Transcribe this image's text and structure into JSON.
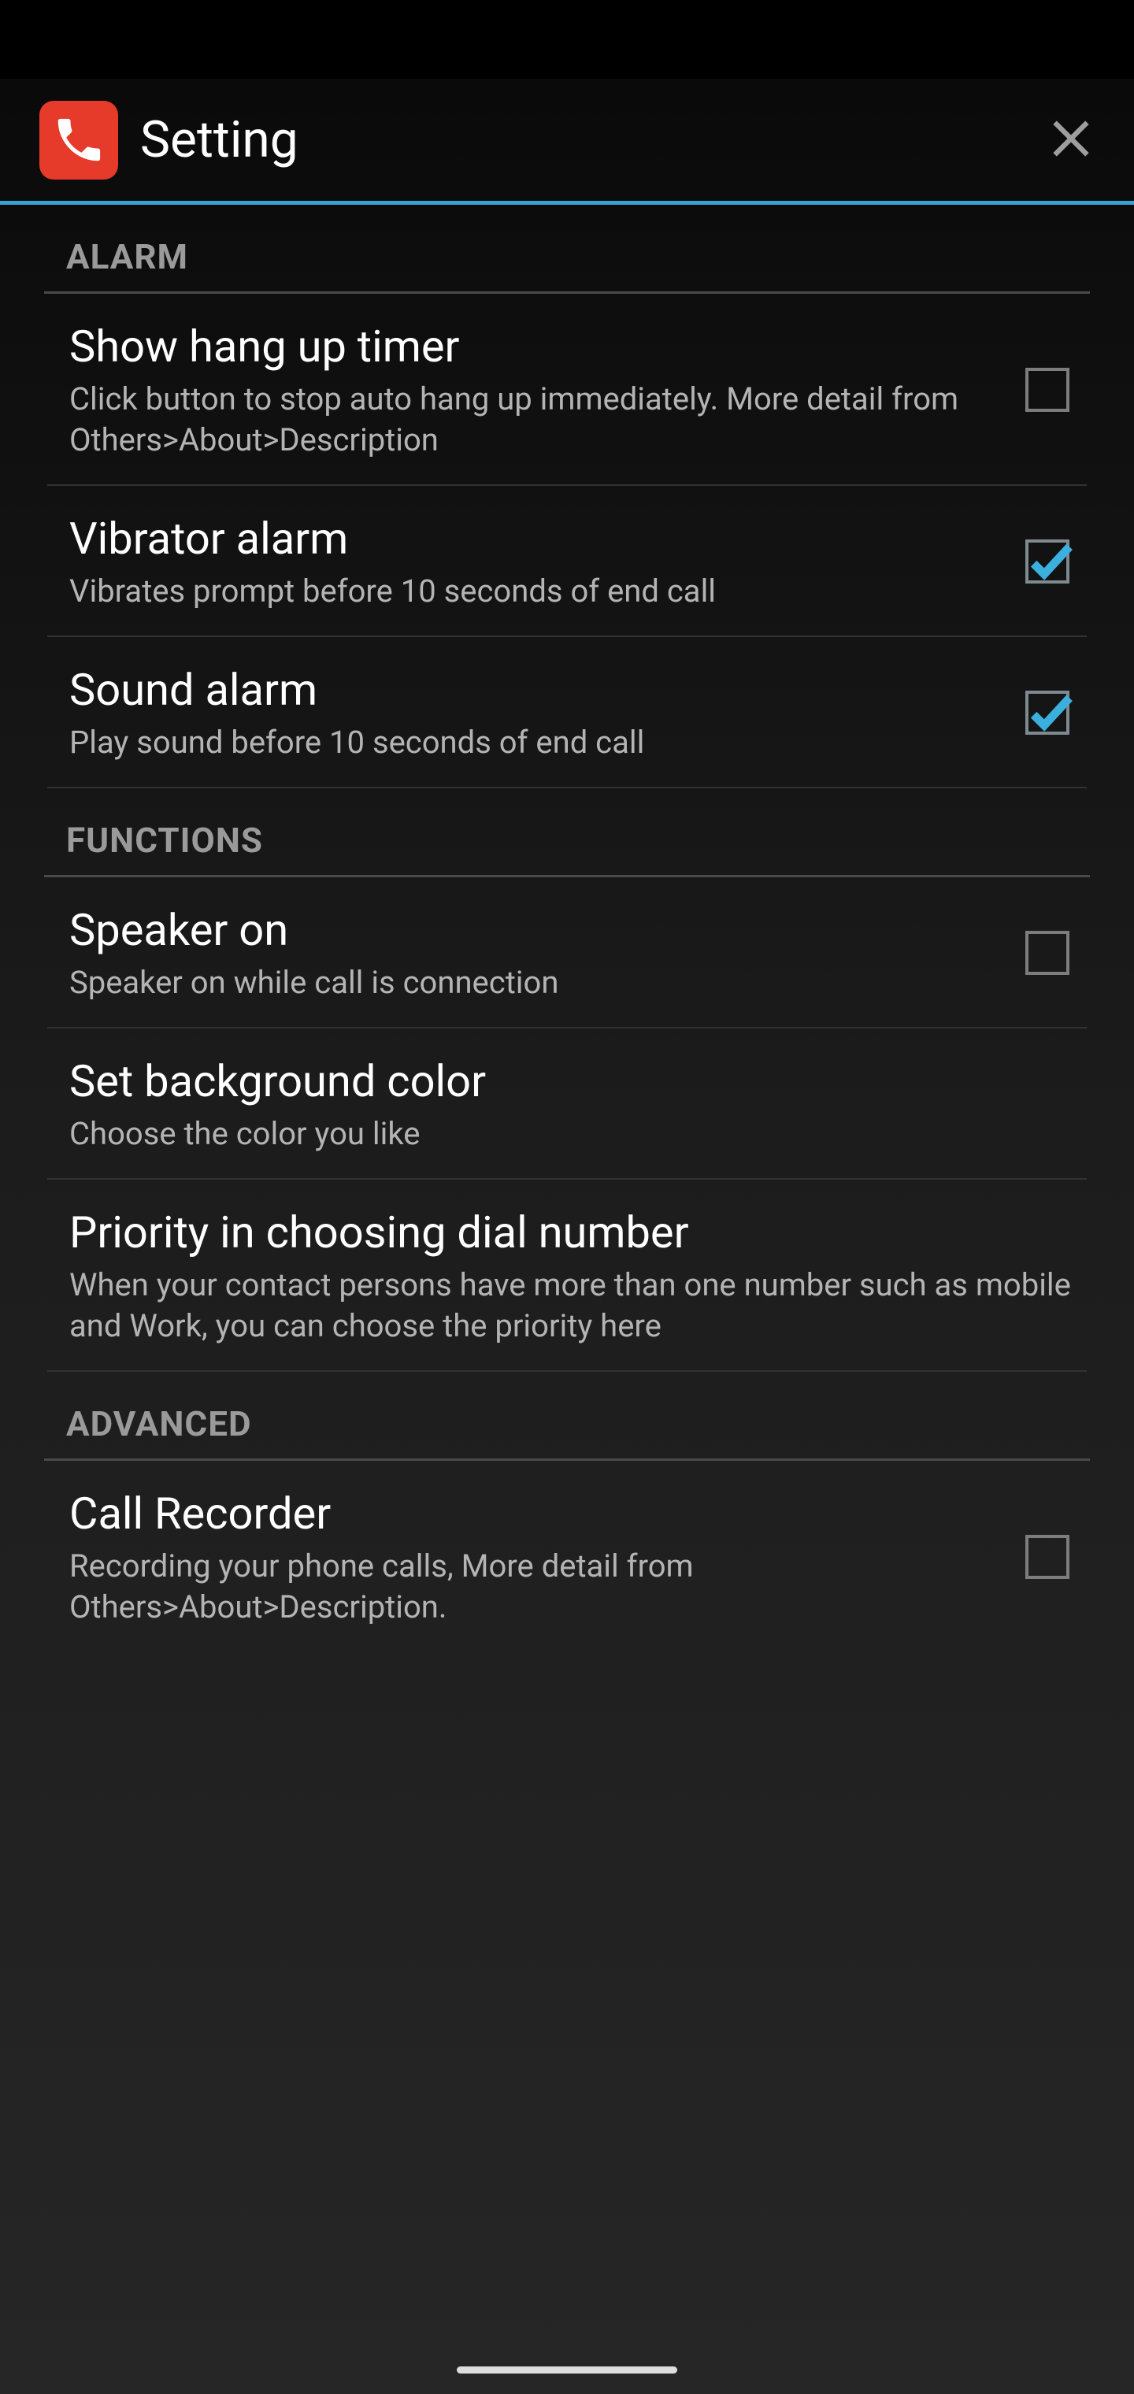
{
  "header": {
    "title": "Setting",
    "app_icon": "phone-icon",
    "close_icon": "close-icon"
  },
  "colors": {
    "accent": "#38a4d0",
    "app_icon_bg": "#e63a2a"
  },
  "sections": [
    {
      "label": "ALARM",
      "items": [
        {
          "title": "Show hang up timer",
          "subtitle": "Click button to stop auto hang up immediately. More detail from Others>About>Description",
          "checkbox": true,
          "checked": false
        },
        {
          "title": "Vibrator alarm",
          "subtitle": "Vibrates prompt before 10 seconds of end call",
          "checkbox": true,
          "checked": true
        },
        {
          "title": "Sound alarm",
          "subtitle": "Play sound before 10 seconds of end call",
          "checkbox": true,
          "checked": true
        }
      ]
    },
    {
      "label": "FUNCTIONS",
      "items": [
        {
          "title": "Speaker on",
          "subtitle": "Speaker on while call is connection",
          "checkbox": true,
          "checked": false
        },
        {
          "title": "Set background color",
          "subtitle": "Choose the color you like",
          "checkbox": false
        },
        {
          "title": "Priority in choosing dial number",
          "subtitle": "When your contact persons have more than one number such as mobile and Work, you can choose the priority here",
          "checkbox": false
        }
      ]
    },
    {
      "label": "ADVANCED",
      "items": [
        {
          "title": "Call Recorder",
          "subtitle": "Recording your phone calls, More detail from Others>About>Description.",
          "checkbox": true,
          "checked": false
        }
      ]
    }
  ]
}
